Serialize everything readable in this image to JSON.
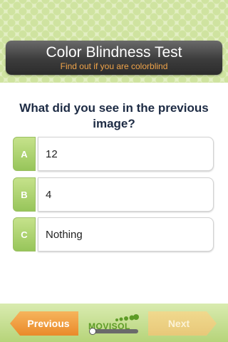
{
  "header": {
    "title": "Color Blindness Test",
    "subtitle": "Find out if you are colorblind"
  },
  "question": "What did you see in the previous image?",
  "answers": [
    {
      "letter": "A",
      "text": "12"
    },
    {
      "letter": "B",
      "text": "4"
    },
    {
      "letter": "C",
      "text": "Nothing"
    }
  ],
  "footer": {
    "previous_label": "Previous",
    "next_label": "Next",
    "logo_text": "MOVISOL",
    "progress": 0.0
  },
  "colors": {
    "accent_green": "#97c55a",
    "previous_orange": "#ea8a2a",
    "next_disabled": "#e8c879",
    "header_dark": "#3c3c3c",
    "subtitle_orange": "#f0a44a"
  }
}
